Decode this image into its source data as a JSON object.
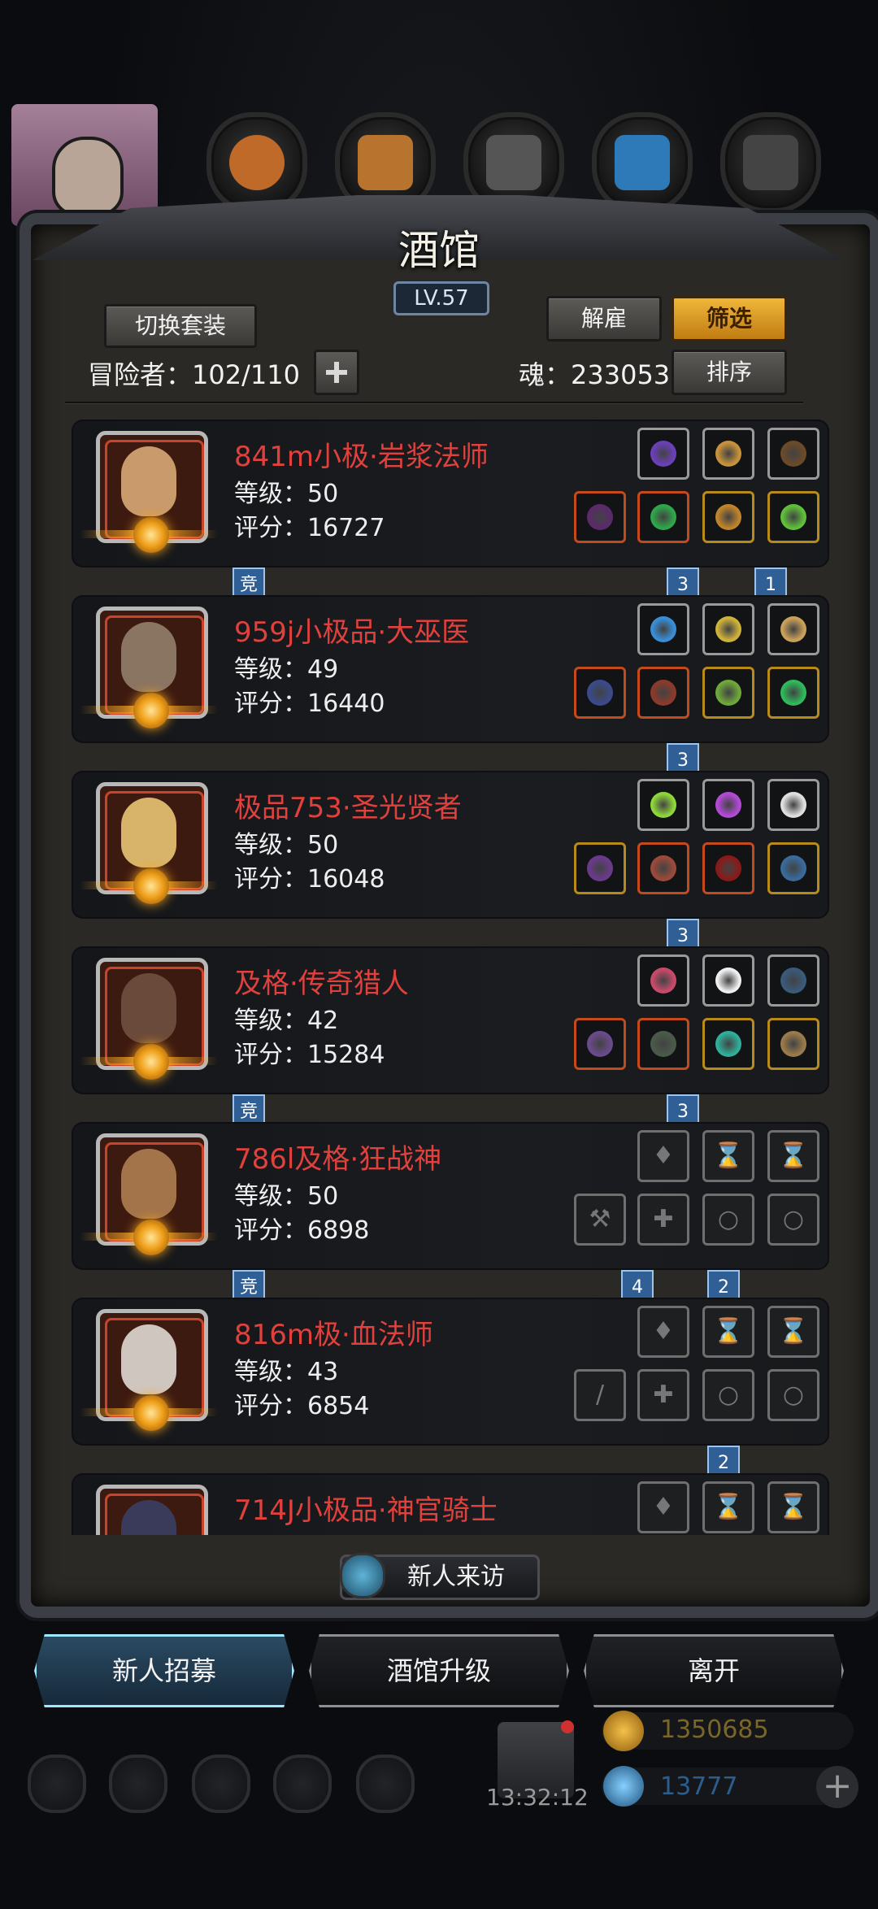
{
  "header": {
    "title": "酒馆",
    "level": "LV.57",
    "switch_set": "切换套装",
    "dismiss": "解雇",
    "filter": "筛选",
    "sort": "排序",
    "adventurers_label": "冒险者：102/110",
    "soul_label": "魂：233053"
  },
  "heroes": [
    {
      "name": "841m小极·岩浆法师",
      "level": "等级：50",
      "score": "评分：16727",
      "portrait": "#c99a6b",
      "tags": [
        {
          "text": "竞",
          "col": "left"
        },
        {
          "text": "3",
          "col": "mid"
        },
        {
          "text": "1",
          "col": "right"
        }
      ],
      "slots_top": [
        {
          "c": "#6a40b8"
        },
        {
          "c": "#c8923a"
        },
        {
          "c": "#6b4a2a"
        }
      ],
      "slots_bottom": [
        {
          "c": "#5a2a6a",
          "frame": "red"
        },
        {
          "c": "#2fa64a",
          "frame": "red"
        },
        {
          "c": "#c0842a",
          "frame": "gold"
        },
        {
          "c": "#5fbf3a",
          "frame": "gold"
        }
      ]
    },
    {
      "name": "959j小极品·大巫医",
      "level": "等级：49",
      "score": "评分：16440",
      "portrait": "#8a7462",
      "tags": [
        {
          "text": "3",
          "col": "mid"
        }
      ],
      "slots_top": [
        {
          "c": "#3a8ed6"
        },
        {
          "c": "#cfb23a"
        },
        {
          "c": "#caa05a"
        }
      ],
      "slots_bottom": [
        {
          "c": "#3a4a8a",
          "frame": "red"
        },
        {
          "c": "#8a3a2a",
          "frame": "red"
        },
        {
          "c": "#6fa83a",
          "frame": "gold"
        },
        {
          "c": "#2fb95a",
          "frame": "gold"
        }
      ]
    },
    {
      "name": "极品753·圣光贤者",
      "level": "等级：50",
      "score": "评分：16048",
      "portrait": "#d8b46a",
      "tags": [
        {
          "text": "3",
          "col": "mid"
        }
      ],
      "slots_top": [
        {
          "c": "#8ed63a"
        },
        {
          "c": "#b34ad6"
        },
        {
          "c": "#e0e0e0"
        }
      ],
      "slots_bottom": [
        {
          "c": "#6a3a8a",
          "frame": "gold"
        },
        {
          "c": "#9a4a3a",
          "frame": "red"
        },
        {
          "c": "#8a1a1a",
          "frame": "red"
        },
        {
          "c": "#3a6a9a",
          "frame": "gold"
        }
      ]
    },
    {
      "name": "及格·传奇猎人",
      "level": "等级：42",
      "score": "评分：15284",
      "portrait": "#6a4a3a",
      "tags": [
        {
          "text": "竞",
          "col": "left"
        },
        {
          "text": "3",
          "col": "mid"
        }
      ],
      "slots_top": [
        {
          "c": "#c84a6a"
        },
        {
          "c": "#f0f0f0"
        },
        {
          "c": "#3a5a7a"
        }
      ],
      "slots_bottom": [
        {
          "c": "#6a4a8a",
          "frame": "red"
        },
        {
          "c": "#4a5a4a",
          "frame": "red"
        },
        {
          "c": "#2fae9a",
          "frame": "gold"
        },
        {
          "c": "#9a7a4a",
          "frame": "gold"
        }
      ]
    },
    {
      "name": "786l及格·狂战神",
      "level": "等级：50",
      "score": "评分：6898",
      "portrait": "#a3734a",
      "tags": [
        {
          "text": "竞",
          "col": "left"
        },
        {
          "text": "4",
          "col": "m2"
        },
        {
          "text": "2",
          "col": "r2"
        }
      ],
      "slots_top": [
        {
          "empty": true,
          "g": "♦"
        },
        {
          "empty": true,
          "g": "⌛"
        },
        {
          "empty": true,
          "g": "⌛"
        }
      ],
      "slots_bottom": [
        {
          "empty": true,
          "g": "⚒"
        },
        {
          "empty": true,
          "g": "✚"
        },
        {
          "empty": true,
          "g": "○"
        },
        {
          "empty": true,
          "g": "○"
        }
      ]
    },
    {
      "name": "816m极·血法师",
      "level": "等级：43",
      "score": "评分：6854",
      "portrait": "#cfc6c0",
      "tags": [
        {
          "text": "2",
          "col": "r2"
        }
      ],
      "slots_top": [
        {
          "empty": true,
          "g": "♦"
        },
        {
          "empty": true,
          "g": "⌛"
        },
        {
          "empty": true,
          "g": "⌛"
        }
      ],
      "slots_bottom": [
        {
          "empty": true,
          "g": "/"
        },
        {
          "empty": true,
          "g": "✚"
        },
        {
          "empty": true,
          "g": "○"
        },
        {
          "empty": true,
          "g": "○"
        }
      ]
    },
    {
      "name": "714J小极品·神官骑士",
      "level": "",
      "score": "",
      "portrait": "#3a3a5a",
      "tags": [],
      "slots_top": [
        {
          "empty": true,
          "g": "♦"
        },
        {
          "empty": true,
          "g": "⌛"
        },
        {
          "empty": true,
          "g": "⌛"
        }
      ],
      "slots_bottom": []
    }
  ],
  "footer": {
    "new_visitor": "新人来访",
    "recruit": "新人招募",
    "upgrade": "酒馆升级",
    "leave": "离开",
    "clock": "13:32:12",
    "gold": "1350685",
    "gems": "13777"
  },
  "colors": {
    "hero_name": "#e0413d",
    "accent_gold": "#f0b73a",
    "tag_blue": "#2f5f95"
  }
}
